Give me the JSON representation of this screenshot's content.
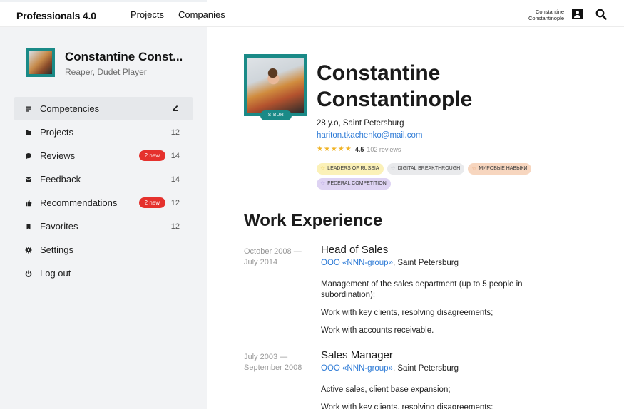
{
  "header": {
    "brand_name": "Professionals",
    "brand_version": "4.0",
    "nav": [
      "Projects",
      "Companies"
    ],
    "user_first": "Constantine",
    "user_last": "Constantinople"
  },
  "sidebar": {
    "name": "Constantine Const...",
    "subtitle": "Reaper, Dudet Player",
    "items": [
      {
        "label": "Competencies",
        "icon": "list-icon",
        "count": "",
        "badge": "",
        "active": true
      },
      {
        "label": "Projects",
        "icon": "folder-icon",
        "count": "12",
        "badge": ""
      },
      {
        "label": "Reviews",
        "icon": "chat-bubble-icon",
        "count": "14",
        "badge": "2 new"
      },
      {
        "label": "Feedback",
        "icon": "envelope-icon",
        "count": "14",
        "badge": ""
      },
      {
        "label": "Recommendations",
        "icon": "thumbs-up-icon",
        "count": "12",
        "badge": "2 new"
      },
      {
        "label": "Favorites",
        "icon": "bookmark-icon",
        "count": "12",
        "badge": ""
      },
      {
        "label": "Settings",
        "icon": "gear-icon",
        "count": "",
        "badge": ""
      },
      {
        "label": "Log out",
        "icon": "power-icon",
        "count": "",
        "badge": ""
      }
    ]
  },
  "profile": {
    "first_name": "Constantine",
    "last_name": "Constantinople",
    "avatar_tag": "SIBUR",
    "age_city": "28 y.o, Saint Petersburg",
    "email": "hariton.tkachenko@mail.com",
    "rating_stars": "★★★★★",
    "rating": "4.5",
    "reviews": "102 reviews",
    "chips": [
      {
        "label": "LEADERS OF RUSSIA",
        "color": "#fbf1b8",
        "star": "#e9c84a"
      },
      {
        "label": "DIGITAL BREAKTHROUGH",
        "color": "#e9eaec",
        "star": "#b8bcc2"
      },
      {
        "label": "МИРОВЫЕ НАВЫКИ",
        "color": "#f7d6bf",
        "star": "#e7a57a"
      },
      {
        "label": "FEDERAL COMPETITION",
        "color": "#ded3f3",
        "star": "#a88fdc"
      }
    ]
  },
  "experience": {
    "title": "Work Experience",
    "jobs": [
      {
        "dates_from": "October 2008 —",
        "dates_to": "July 2014",
        "title": "Head of Sales",
        "company": "OOO «NNN-group»",
        "city": ", Saint Petersburg",
        "duties": [
          "Management of the sales department (up to 5 people in subordination);",
          "Work with key clients, resolving disagreements;",
          "Work with accounts receivable."
        ]
      },
      {
        "dates_from": "July 2003 —",
        "dates_to": "September 2008",
        "title": "Sales Manager",
        "company": "OOO «NNN-group»",
        "city": ", Saint Petersburg",
        "duties": [
          "Active sales, client base expansion;",
          "Work with key clients, resolving disagreements;"
        ]
      }
    ]
  },
  "colors": {
    "accent": "#1a8a87",
    "link": "#2e7bd6",
    "badge": "#e5312d"
  }
}
